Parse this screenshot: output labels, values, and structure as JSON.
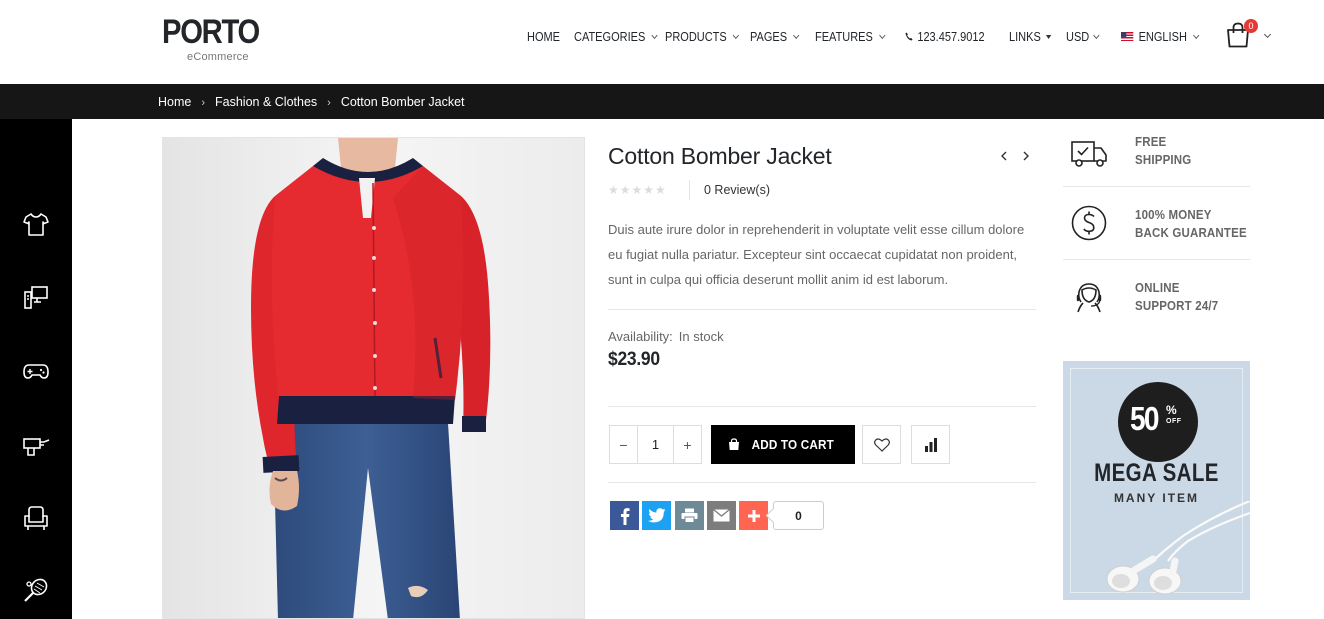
{
  "header": {
    "logo_main": "PORTO",
    "logo_sub": "eCommerce",
    "nav": [
      {
        "label": "HOME",
        "dropdown": false
      },
      {
        "label": "CATEGORIES",
        "dropdown": true
      },
      {
        "label": "PRODUCTS",
        "dropdown": true
      },
      {
        "label": "PAGES",
        "dropdown": true
      },
      {
        "label": "FEATURES",
        "dropdown": true
      }
    ],
    "phone": "123.457.9012",
    "links_label": "LINKS",
    "currency": "USD",
    "language": "ENGLISH",
    "cart_count": "0"
  },
  "breadcrumb": {
    "items": [
      "Home",
      "Fashion & Clothes",
      "Cotton Bomber Jacket"
    ],
    "separator": "›"
  },
  "sidebar": {
    "icons": [
      "tshirt-icon",
      "computer-icon",
      "gamepad-icon",
      "drill-icon",
      "armchair-icon",
      "tennis-racket-icon"
    ]
  },
  "product": {
    "title": "Cotton Bomber Jacket",
    "rating": 0,
    "reviews": "0 Review(s)",
    "description": "Duis aute irure dolor in reprehenderit in voluptate velit esse cillum dolore eu fugiat nulla pariatur. Excepteur sint occaecat cupidatat non proident, sunt in culpa qui officia deserunt mollit anim id est laborum.",
    "availability_label": "Availability:",
    "availability_value": "In stock",
    "price": "$23.90",
    "quantity": "1",
    "qty_minus": "−",
    "qty_plus": "+",
    "add_to_cart": "ADD TO CART",
    "share_count": "0"
  },
  "features": [
    {
      "line1": "FREE",
      "line2": "SHIPPING",
      "icon": "truck-icon"
    },
    {
      "line1": "100% MONEY",
      "line2": "BACK GUARANTEE",
      "icon": "dollar-icon"
    },
    {
      "line1": "ONLINE",
      "line2": "SUPPORT 24/7",
      "icon": "support-icon"
    }
  ],
  "banner": {
    "discount": "50",
    "percent": "%",
    "off": "OFF",
    "title": "MEGA SALE",
    "subtitle": "MANY ITEM"
  },
  "colors": {
    "dark": "#161616",
    "accent_red": "#e53935",
    "facebook": "#3b5998",
    "twitter": "#1da1f2",
    "print": "#6d8a96",
    "email": "#7d7d7d",
    "plus": "#ff6550",
    "banner_bg": "#cbd9e6"
  }
}
